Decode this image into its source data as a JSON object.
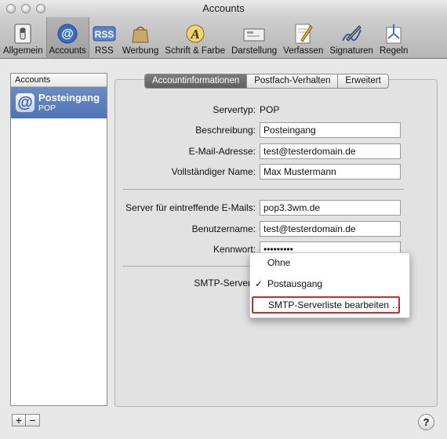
{
  "window": {
    "title": "Accounts"
  },
  "toolbar": {
    "items": [
      {
        "label": "Allgemein",
        "icon": "switch-icon"
      },
      {
        "label": "Accounts",
        "icon": "at-sign-icon"
      },
      {
        "label": "RSS",
        "icon": "rss-icon",
        "icon_text": "RSS"
      },
      {
        "label": "Werbung",
        "icon": "junk-bag-icon"
      },
      {
        "label": "Schrift & Farbe",
        "icon": "font-icon",
        "icon_text": "A"
      },
      {
        "label": "Darstellung",
        "icon": "viewing-icon"
      },
      {
        "label": "Verfassen",
        "icon": "compose-icon"
      },
      {
        "label": "Signaturen",
        "icon": "signature-icon"
      },
      {
        "label": "Regeln",
        "icon": "rules-icon"
      }
    ]
  },
  "sidebar": {
    "header": "Accounts",
    "account": {
      "icon_text": "@",
      "name": "Posteingang",
      "type": "POP"
    },
    "add_label": "+",
    "remove_label": "−"
  },
  "tabs": [
    "Accountinformationen",
    "Postfach-Verhalten",
    "Erweitert"
  ],
  "form": {
    "servertyp_label": "Servertyp:",
    "servertyp_value": "POP",
    "beschreibung_label": "Beschreibung:",
    "beschreibung_value": "Posteingang",
    "email_label": "E-Mail-Adresse:",
    "email_value": "test@testerdomain.de",
    "name_label": "Vollständiger Name:",
    "name_value": "Max Mustermann",
    "incoming_label": "Server für eintreffende E-Mails:",
    "incoming_value": "pop3.3wm.de",
    "user_label": "Benutzername:",
    "user_value": "test@testerdomain.de",
    "password_label": "Kennwort:",
    "password_value": "•••••••••",
    "smtp_label": "SMTP-Server"
  },
  "smtp_menu": {
    "items": [
      {
        "label": "Ohne",
        "checked": false
      },
      {
        "label": "Postausgang",
        "checked": true
      },
      {
        "label": "SMTP-Serverliste bearbeiten …",
        "checked": false
      }
    ],
    "check_glyph": "✓"
  },
  "help_label": "?",
  "colors": {
    "selection": "#4f74b6",
    "highlight_border": "#c2302c"
  }
}
